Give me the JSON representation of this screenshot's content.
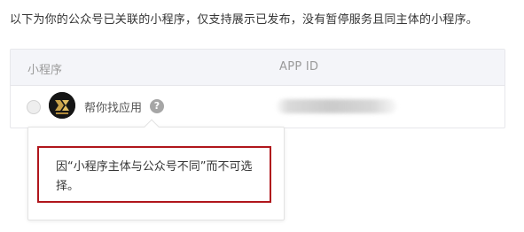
{
  "intro_text": "以下为你的公众号已关联的小程序，仅支持展示已发布，没有暂停服务且同主体的小程序。",
  "table": {
    "columns": [
      "小程序",
      "APP ID"
    ],
    "rows": [
      {
        "name": "帮你找应用",
        "app_id": "",
        "selected": false,
        "avatar_icon": "app-logo"
      }
    ]
  },
  "help_icon": {
    "glyph": "?"
  },
  "tooltip": {
    "text": "因“小程序主体与公众号不同”而不可选择。"
  },
  "colors": {
    "header_bg": "#f4f5f9",
    "border": "#e7e7eb",
    "highlight_border": "#b0161c",
    "help_icon_bg": "#a6a6a6"
  }
}
